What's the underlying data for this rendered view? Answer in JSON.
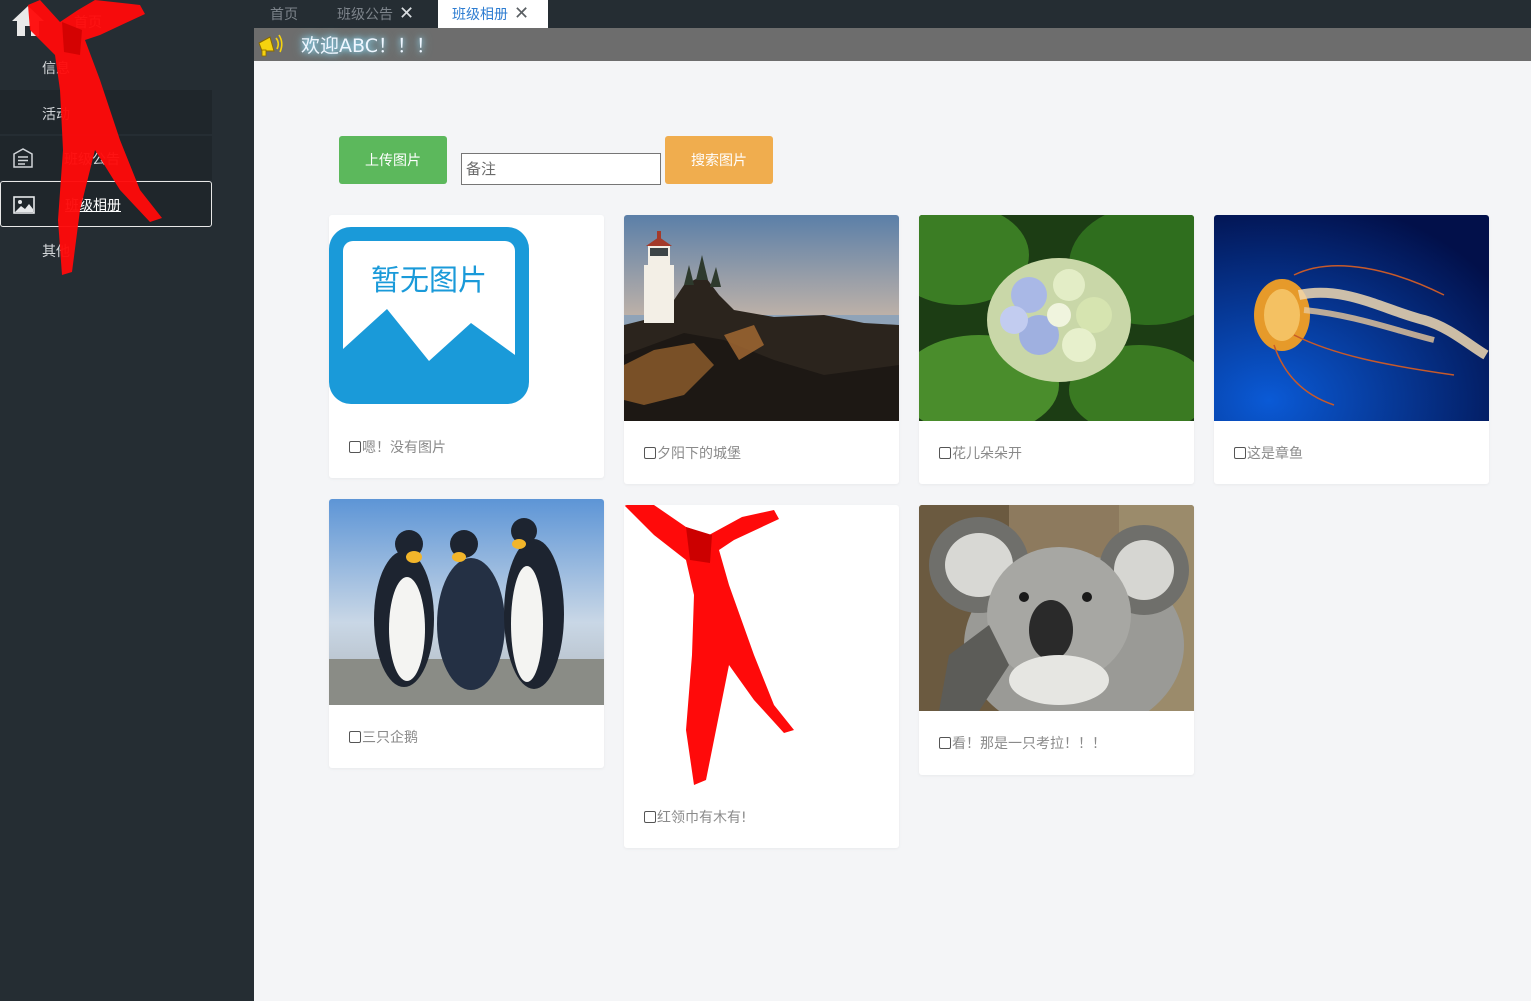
{
  "sidebar": {
    "items": [
      {
        "label": "首页",
        "icon": "home-icon"
      },
      {
        "label": "信息",
        "icon": ""
      },
      {
        "label": "活动",
        "icon": ""
      },
      {
        "label": "班级公告",
        "icon": "announcement-icon"
      },
      {
        "label": "班级相册",
        "icon": "image-icon",
        "active": true
      },
      {
        "label": "其他",
        "icon": ""
      }
    ]
  },
  "tabs": [
    {
      "label": "首页",
      "closable": false
    },
    {
      "label": "班级公告",
      "closable": true
    },
    {
      "label": "班级相册",
      "closable": true,
      "active": true
    }
  ],
  "tab_close_glyph": "✕",
  "marquee": {
    "text": "欢迎ABC！！！"
  },
  "toolbar": {
    "upload_label": "上传图片",
    "remark_placeholder": "备注",
    "search_label": "搜索图片"
  },
  "album": [
    {
      "caption": "嗯！没有图片",
      "image": "no-image-placeholder",
      "placeholder_text": "暂无图片"
    },
    {
      "caption": "夕阳下的城堡",
      "image": "lighthouse-sunset"
    },
    {
      "caption": "花儿朵朵开",
      "image": "hydrangea-flower"
    },
    {
      "caption": "这是章鱼",
      "image": "jellyfish"
    },
    {
      "caption": "三只企鹅",
      "image": "penguins"
    },
    {
      "caption": "红领巾有木有!",
      "image": "red-scarf"
    },
    {
      "caption": "看！那是一只考拉！！！",
      "image": "koala"
    }
  ],
  "colors": {
    "sidebar_bg": "#252d33",
    "upload_btn": "#5cb85c",
    "search_btn": "#f0ad4e",
    "active_tab_text": "#2e7dd1",
    "placeholder_blue": "#1a9ad9",
    "scarf_red": "#ff0a0a"
  }
}
